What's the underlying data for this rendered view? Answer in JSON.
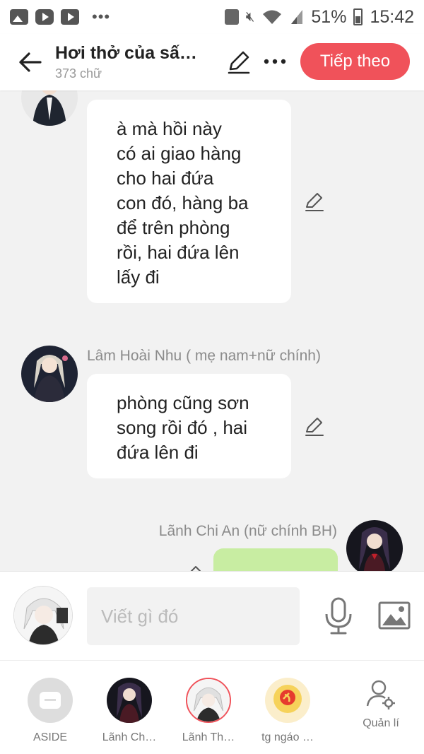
{
  "status_bar": {
    "battery_percent": "51%",
    "time": "15:42",
    "icons": [
      "gallery-icon",
      "video-icon",
      "youtube-icon",
      "more-dots-icon",
      "battery-saver-icon",
      "mute-icon",
      "wifi-icon",
      "signal-icon",
      "battery-icon"
    ]
  },
  "header": {
    "title": "Hơi thở của sấ…",
    "word_count": "373 chữ",
    "next_label": "Tiếp theo",
    "next_color": "#f0525a"
  },
  "messages": [
    {
      "speaker": "",
      "text": "à mà hồi này\ncó ai giao hàng\ncho hai đứa\ncon đó, hàng ba\nđể trên phòng\nrồi, hai đứa lên\nlấy đi",
      "side": "left"
    },
    {
      "speaker": "Lâm Hoài Nhu ( mẹ nam+nữ chính)",
      "text": "phòng cũng sơn\nsong rồi đó , hai\nđứa lên đi",
      "side": "left"
    },
    {
      "speaker": "Lãnh Chi An (nữ chính BH)",
      "text": "",
      "side": "right",
      "bubble_color": "#c8eda2"
    }
  ],
  "composer": {
    "placeholder": "Viết gì đó"
  },
  "bottom_bar": {
    "items": [
      {
        "label": "ASIDE"
      },
      {
        "label": "Lãnh Ch…"
      },
      {
        "label": "Lãnh Th…"
      },
      {
        "label": "tg ngáo …"
      },
      {
        "label": "Quản lí"
      }
    ]
  }
}
